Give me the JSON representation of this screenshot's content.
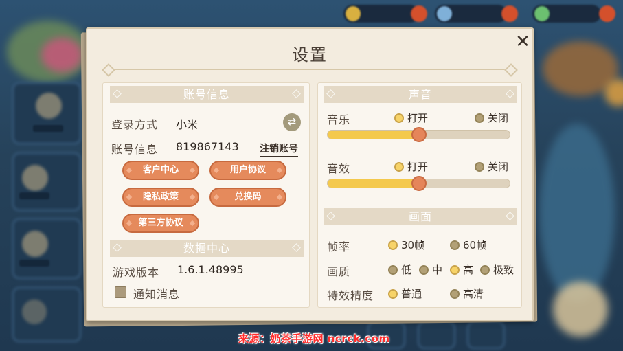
{
  "dialog": {
    "title": "设置",
    "close_icon": "close-icon"
  },
  "account": {
    "section_title": "账号信息",
    "login_label": "登录方式",
    "login_value": "小米",
    "switch_icon": "swap-icon",
    "account_label": "账号信息",
    "account_value": "819867143",
    "cancel_account_link": "注销账号",
    "buttons": {
      "customer_center": "客户中心",
      "user_agreement": "用户协议",
      "privacy_policy": "隐私政策",
      "redeem_code": "兑换码",
      "third_party_agreement": "第三方协议"
    }
  },
  "data_center": {
    "section_title": "数据中心",
    "version_label": "游戏版本",
    "version_value": "1.6.1.48995",
    "notify_label": "通知消息",
    "notify_checked": true
  },
  "sound": {
    "section_title": "声音",
    "music_label": "音乐",
    "music_on": "打开",
    "music_off": "关闭",
    "music_level": 0.5,
    "sfx_label": "音效",
    "sfx_on": "打开",
    "sfx_off": "关闭",
    "sfx_level": 0.5
  },
  "display": {
    "section_title": "画面",
    "fps_label": "帧率",
    "fps_options": [
      "30帧",
      "60帧"
    ],
    "fps_selected": "30帧",
    "quality_label": "画质",
    "quality_options": [
      "低",
      "中",
      "高",
      "极致"
    ],
    "quality_selected": "高",
    "effects_label": "特效精度",
    "effects_options": [
      "普通",
      "高清"
    ],
    "effects_selected": "普通"
  },
  "watermark": "来源：奶茶手游网 ncrck.com",
  "colors": {
    "accent_orange": "#e58a5c",
    "slider_fill": "#f4c94d",
    "panel_bg": "#faf6ef"
  }
}
